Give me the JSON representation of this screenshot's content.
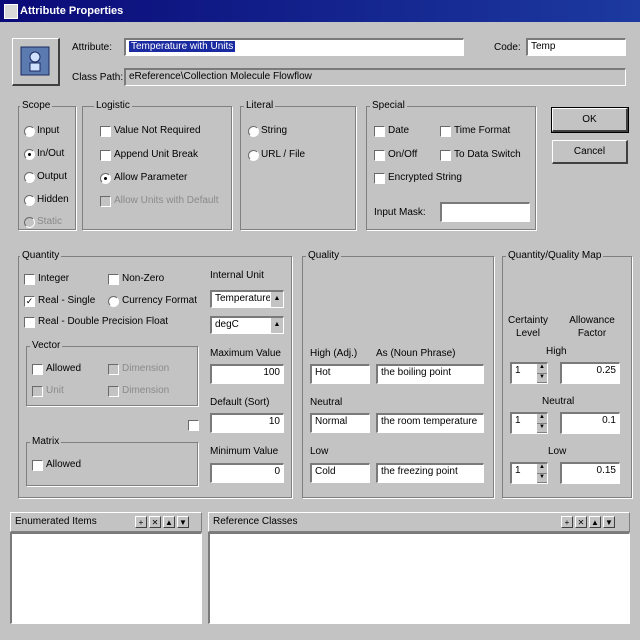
{
  "window": {
    "title": "Attribute Properties"
  },
  "header": {
    "attribute_label": "Attribute:",
    "attribute_value": "Temperature with Units",
    "code_label": "Code:",
    "code_value": "Temp",
    "classpath_label": "Class Path:",
    "classpath_value": "eReference\\Collection Molecule Flowflow"
  },
  "scope": {
    "title": "Scope",
    "options": [
      "Input",
      "In/Out",
      "Output",
      "Hidden",
      "Static"
    ],
    "selected": 1
  },
  "logistic": {
    "title": "Logistic",
    "options": [
      "Value Not Required",
      "Append Unit Break",
      "Allow Parameter",
      "Allow Units with Default"
    ],
    "selected_radio": 2
  },
  "literal": {
    "title": "Literal",
    "options": [
      "String",
      "URL / File"
    ]
  },
  "special": {
    "title": "Special",
    "options": [
      "Date",
      "Time Format",
      "On/Off",
      "To Data Switch",
      "Encrypted String"
    ],
    "input_mask_label": "Input Mask:",
    "input_mask_value": ""
  },
  "buttons": {
    "ok": "OK",
    "cancel": "Cancel"
  },
  "quantity": {
    "title": "Quantity",
    "integer": "Integer",
    "nonzero": "Non-Zero",
    "real_single": "Real - Single",
    "currency": "Currency Format",
    "real_double": "Real - Double Precision Float",
    "internal_unit_label": "Internal Unit",
    "internal_unit_value": "Temperature",
    "unit_value": "degC",
    "max_label": "Maximum Value",
    "max_value": "100",
    "default_label": "Default (Sort)",
    "default_value": "10",
    "min_label": "Minimum Value",
    "min_value": "0"
  },
  "vector": {
    "title": "Vector",
    "allowed": "Allowed",
    "opt2": "Dimension",
    "opt3": "Unit",
    "opt4": "Dimension"
  },
  "matrix": {
    "title": "Matrix",
    "allowed": "Allowed"
  },
  "quality": {
    "title": "Quality",
    "high_label": "High (Adj.)",
    "as_label": "As (Noun Phrase)",
    "high_value": "Hot",
    "high_phrase": "the boiling point",
    "neutral_label": "Neutral",
    "neutral_value": "Normal",
    "neutral_phrase": "the room temperature",
    "low_label": "Low",
    "low_value": "Cold",
    "low_phrase": "the freezing point"
  },
  "qqmap": {
    "title": "Quantity/Quality Map",
    "certainty_label": "Certainty Level",
    "allowance_label": "Allowance Factor",
    "high_label": "High",
    "high_level": "1",
    "high_factor": "0.25",
    "neutral_label": "Neutral",
    "neutral_level": "1",
    "neutral_factor": "0.1",
    "low_label": "Low",
    "low_level": "1",
    "low_factor": "0.15"
  },
  "enumerated": {
    "title": "Enumerated Items"
  },
  "reference": {
    "title": "Reference Classes"
  }
}
